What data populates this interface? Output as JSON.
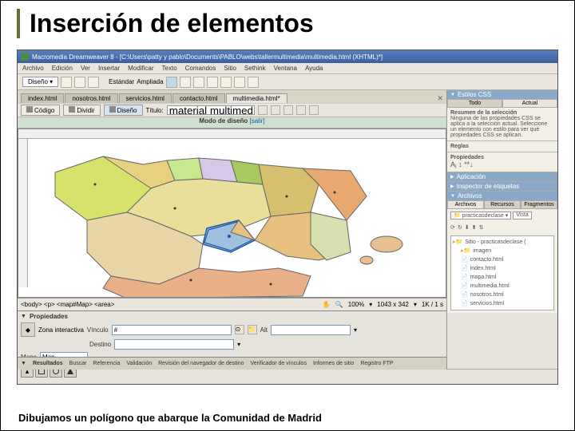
{
  "slide": {
    "title": "Inserción de elementos",
    "caption": "Dibujamos un polígono que abarque la Comunidad de Madrid"
  },
  "titlebar": "Macromedia Dreamweaver 8 - [C:\\Users\\patty y pablo\\Documents\\PABLO\\webs\\tallermultimedia\\multimedia.html (XHTML)*]",
  "menu": [
    "Archivo",
    "Edición",
    "Ver",
    "Insertar",
    "Modificar",
    "Texto",
    "Comandos",
    "Sitio",
    "Sethink",
    "Ventana",
    "Ayuda"
  ],
  "insert_category": "Diseño",
  "tabs": [
    "index.html",
    "nosotros.html",
    "servicios.html",
    "contacto.html",
    "multimedia.html*"
  ],
  "active_tab": 4,
  "doc_toolbar": {
    "code": "Código",
    "split": "Dividir",
    "design": "Diseño",
    "title_label": "Título:",
    "title_value": "material multimedia"
  },
  "design_mode": {
    "label": "Modo de diseño",
    "link": "[salir]"
  },
  "status": {
    "tagpath": "<body> <p> <map#Map> <area>",
    "zoom": "100%",
    "dim": "1043 x 342",
    "size": "1K / 1 s"
  },
  "properties": {
    "panel": "Propiedades",
    "zone": "Zona interactiva",
    "link_label": "Vínculo",
    "link_value": "#",
    "dest_label": "Destino",
    "alt_label": "Alt",
    "map_label": "Mapa",
    "map_value": "Map"
  },
  "results": {
    "panel": "Resultados",
    "tabs": [
      "Buscar",
      "Referencia",
      "Validación",
      "Revisión del navegador de destino",
      "Verificador de vínculos",
      "Informes de sitio",
      "Registro FTP"
    ]
  },
  "side": {
    "css_head": "Estilos CSS",
    "css_tabs": [
      "Todo",
      "Actual"
    ],
    "css_summary_head": "Resumen de la selección",
    "css_summary": "Ninguna de las propiedades CSS se aplica a la selección actual. Seleccione un elemento con estilo para ver qué propiedades CSS se aplican.",
    "rules_head": "Reglas",
    "props_head": "Propiedades",
    "app_head": "Aplicación",
    "tag_head": "Inspector de etiquetas",
    "files_head": "Archivos",
    "files_tabs": [
      "Archivos",
      "Recursos",
      "Fragmentos"
    ],
    "site_sel": "practicasdeclase",
    "view_sel": "Vista",
    "tree": {
      "root": "Sitio - practicasdeclase (",
      "items": [
        "imagen",
        "contacto.html",
        "index.html",
        "mapa.html",
        "multimedia.html",
        "nosotros.html",
        "servicios.html"
      ]
    }
  }
}
